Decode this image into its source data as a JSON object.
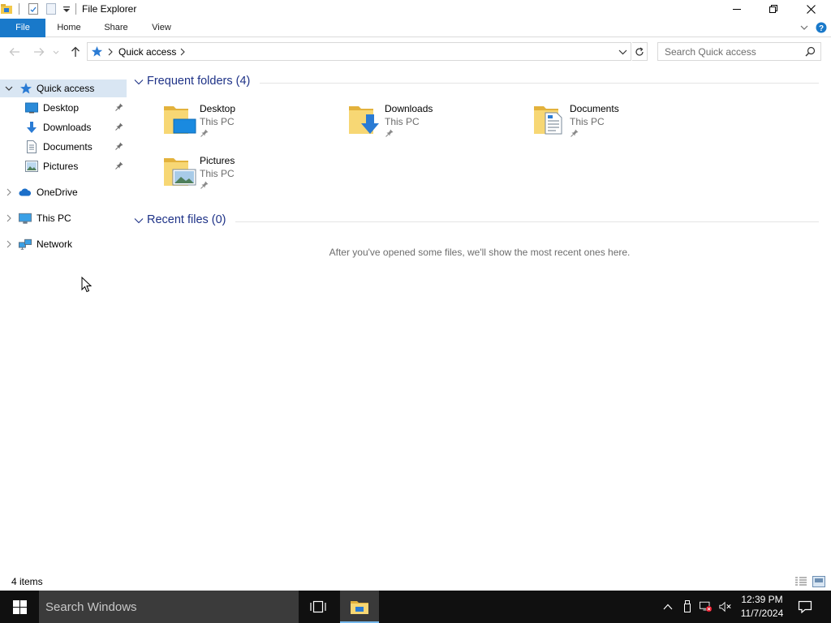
{
  "window": {
    "title": "File Explorer"
  },
  "ribbon": {
    "tabs": [
      "File",
      "Home",
      "Share",
      "View"
    ]
  },
  "address": {
    "location": "Quick access"
  },
  "search": {
    "placeholder": "Search Quick access"
  },
  "sidebar": {
    "items": [
      {
        "label": "Quick access",
        "icon": "star-icon"
      },
      {
        "label": "Desktop",
        "icon": "desktop-icon",
        "pinned": true
      },
      {
        "label": "Downloads",
        "icon": "download-icon",
        "pinned": true
      },
      {
        "label": "Documents",
        "icon": "document-icon",
        "pinned": true
      },
      {
        "label": "Pictures",
        "icon": "pictures-icon",
        "pinned": true
      },
      {
        "label": "OneDrive",
        "icon": "cloud-icon"
      },
      {
        "label": "This PC",
        "icon": "computer-icon"
      },
      {
        "label": "Network",
        "icon": "network-icon"
      }
    ]
  },
  "frequent": {
    "title": "Frequent folders (4)",
    "folders": [
      {
        "name": "Desktop",
        "location": "This PC"
      },
      {
        "name": "Downloads",
        "location": "This PC"
      },
      {
        "name": "Documents",
        "location": "This PC"
      },
      {
        "name": "Pictures",
        "location": "This PC"
      }
    ]
  },
  "recent": {
    "title": "Recent files (0)",
    "empty_message": "After you've opened some files, we'll show the most recent ones here."
  },
  "status": {
    "item_count": "4 items"
  },
  "taskbar": {
    "search_placeholder": "Search Windows",
    "time": "12:39 PM",
    "date": "11/7/2024"
  },
  "colors": {
    "accent": "#1979ca",
    "header_text": "#1e3287",
    "selection": "#d9e6f3",
    "folder": "#f2c94c",
    "taskbar": "#101010"
  }
}
